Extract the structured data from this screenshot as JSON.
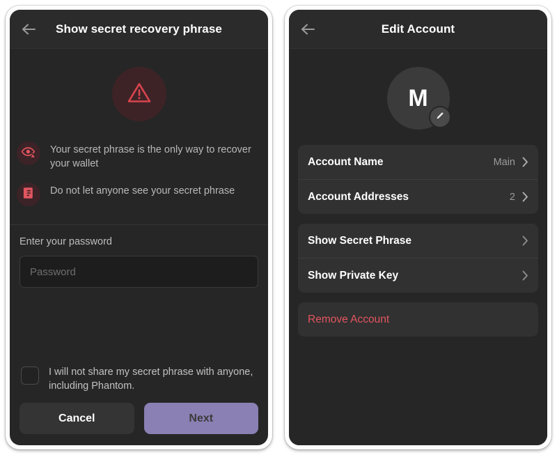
{
  "theme": {
    "screen_bg": "#262626",
    "header_bg": "#2b2b2b",
    "group_bg": "#313131",
    "accent_purple": "#8a80b4",
    "danger_red": "#e2555f",
    "warning_badge_bg": "#3e2326",
    "text_primary": "#ffffff",
    "text_secondary": "#b9b9b9"
  },
  "left_panel": {
    "header": {
      "title": "Show secret recovery phrase",
      "back_icon": "arrow-left-icon"
    },
    "warning_icon": "warning-triangle-icon",
    "warnings": [
      {
        "icon": "eye-warning-icon",
        "text": "Your secret phrase is the only way to recover your wallet"
      },
      {
        "icon": "document-warning-icon",
        "text": "Do not let anyone see your secret phrase"
      }
    ],
    "password": {
      "label": "Enter your password",
      "value": "",
      "placeholder": "Password"
    },
    "consent": {
      "checked": false,
      "text": "I will not share my secret phrase with anyone, including Phantom."
    },
    "buttons": {
      "cancel_label": "Cancel",
      "next_label": "Next"
    }
  },
  "right_panel": {
    "header": {
      "title": "Edit Account",
      "back_icon": "arrow-left-icon"
    },
    "avatar": {
      "letter": "M",
      "edit_icon": "pencil-icon"
    },
    "groups": [
      {
        "rows": [
          {
            "label": "Account Name",
            "value": "Main",
            "chevron": "chevron-right-icon",
            "danger": false
          },
          {
            "label": "Account Addresses",
            "value": "2",
            "chevron": "chevron-right-icon",
            "danger": false
          }
        ]
      },
      {
        "rows": [
          {
            "label": "Show Secret Phrase",
            "value": "",
            "chevron": "chevron-right-icon",
            "danger": false
          },
          {
            "label": "Show Private Key",
            "value": "",
            "chevron": "chevron-right-icon",
            "danger": false
          }
        ]
      },
      {
        "rows": [
          {
            "label": "Remove Account",
            "value": "",
            "chevron": "",
            "danger": true
          }
        ]
      }
    ]
  }
}
